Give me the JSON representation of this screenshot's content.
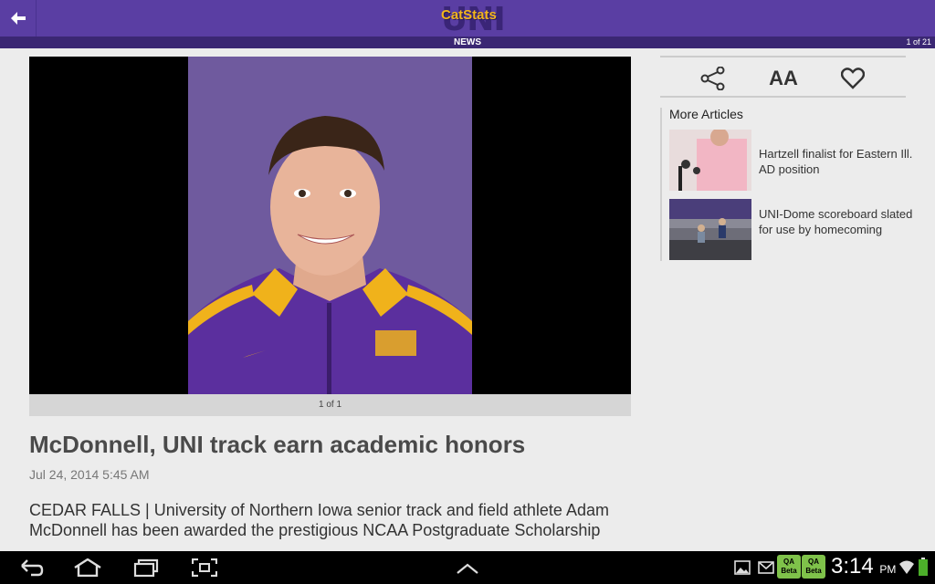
{
  "header": {
    "logo_text_top": "CatStats",
    "logo_text_bottom": "UNI",
    "section": "NEWS",
    "page_counter": "1 of 21"
  },
  "article": {
    "photo_caption": "1 of 1",
    "headline": "McDonnell, UNI track earn academic honors",
    "date": "Jul 24, 2014 5:45 AM",
    "body": "CEDAR FALLS | University of Northern Iowa senior track and field athlete Adam McDonnell has been awarded the prestigious NCAA Postgraduate Scholarship"
  },
  "sidebar": {
    "tools": [
      "share-icon",
      "text-size-icon",
      "heart-icon"
    ],
    "text_size_label": "AA",
    "more_title": "More Articles",
    "articles": [
      {
        "title": "Hartzell finalist for Eastern Ill. AD position"
      },
      {
        "title": "UNI-Dome scoreboard slated for use by homecoming"
      }
    ]
  },
  "system": {
    "time": "3:14",
    "ampm": "PM",
    "badge1": "QA Beta",
    "badge2": "QA Beta"
  },
  "colors": {
    "brand_purple": "#5a3ea3",
    "brand_gold": "#f2b51c"
  }
}
